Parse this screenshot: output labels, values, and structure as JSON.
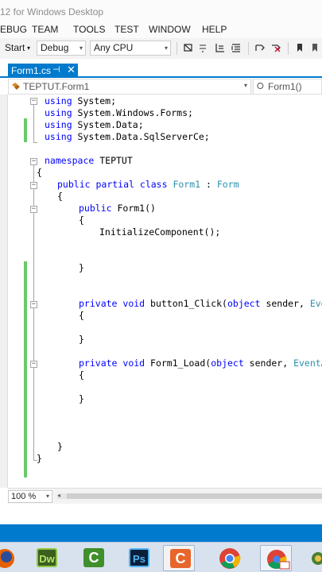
{
  "window": {
    "title": "12 for Windows Desktop"
  },
  "menu": [
    "EBUG",
    "TEAM",
    "TOOLS",
    "TEST",
    "WINDOW",
    "HELP"
  ],
  "toolbar": {
    "start_label": "Start",
    "start_arrow": "▾",
    "configuration": "Debug",
    "platform": "Any CPU",
    "dropdown_arrow": "▾"
  },
  "tab": {
    "label": "Form1.cs",
    "pin": "⊣",
    "close": "✕"
  },
  "nav": {
    "type_dropdown": "TEPTUT.Form1",
    "member_dropdown": "Form1()",
    "member_icon": "⭘",
    "dropdown_arrow": "▾"
  },
  "code": {
    "using1": [
      "using",
      " System;"
    ],
    "using2": [
      "using",
      " System.Windows.Forms;"
    ],
    "using3": [
      "using",
      " System.Data;"
    ],
    "using4": [
      "using",
      " System.Data.SqlServerCe;"
    ],
    "ns": [
      "namespace",
      " TEPTUT"
    ],
    "brace_open": "{",
    "class_pub": "public",
    "class_partial": "partial",
    "class_kw": "class",
    "class_name": "Form1",
    "class_sep": " : ",
    "class_base": "Form",
    "ctor_pub": "public",
    "ctor_rest": " Form1()",
    "ctor_body": "InitializeComponent();",
    "brace_close": "}",
    "m1_priv": "private",
    "m1_void": "void",
    "m1_name": " button1_Click(",
    "m1_obj": "object",
    "m1_sender": " sender, ",
    "m1_args": "Event",
    "m2_priv": "private",
    "m2_void": "void",
    "m2_name": " Form1_Load(",
    "m2_obj": "object",
    "m2_sender": " sender, ",
    "m2_args": "EventArg"
  },
  "fold_glyph": "−",
  "zoom": {
    "value": "100 %",
    "arrow": "▾"
  },
  "scroll_left": "◂",
  "colors": {
    "accent": "#007acc",
    "keyword": "#0000ff",
    "type": "#2b91af",
    "change_bar": "#6cc86c"
  },
  "taskbar": {
    "apps": [
      {
        "icon": "firefox-icon",
        "text": ""
      },
      {
        "icon": "dreamweaver-icon",
        "text": "Dw"
      },
      {
        "icon": "camtasia-icon",
        "text": "C"
      },
      {
        "icon": "photoshop-icon",
        "text": "Ps"
      },
      {
        "icon": "camtasia-recorder-icon",
        "text": "C"
      },
      {
        "icon": "chrome-icon",
        "text": ""
      },
      {
        "icon": "chrome-active-icon",
        "text": ""
      },
      {
        "icon": "app-icon",
        "text": ""
      }
    ]
  }
}
